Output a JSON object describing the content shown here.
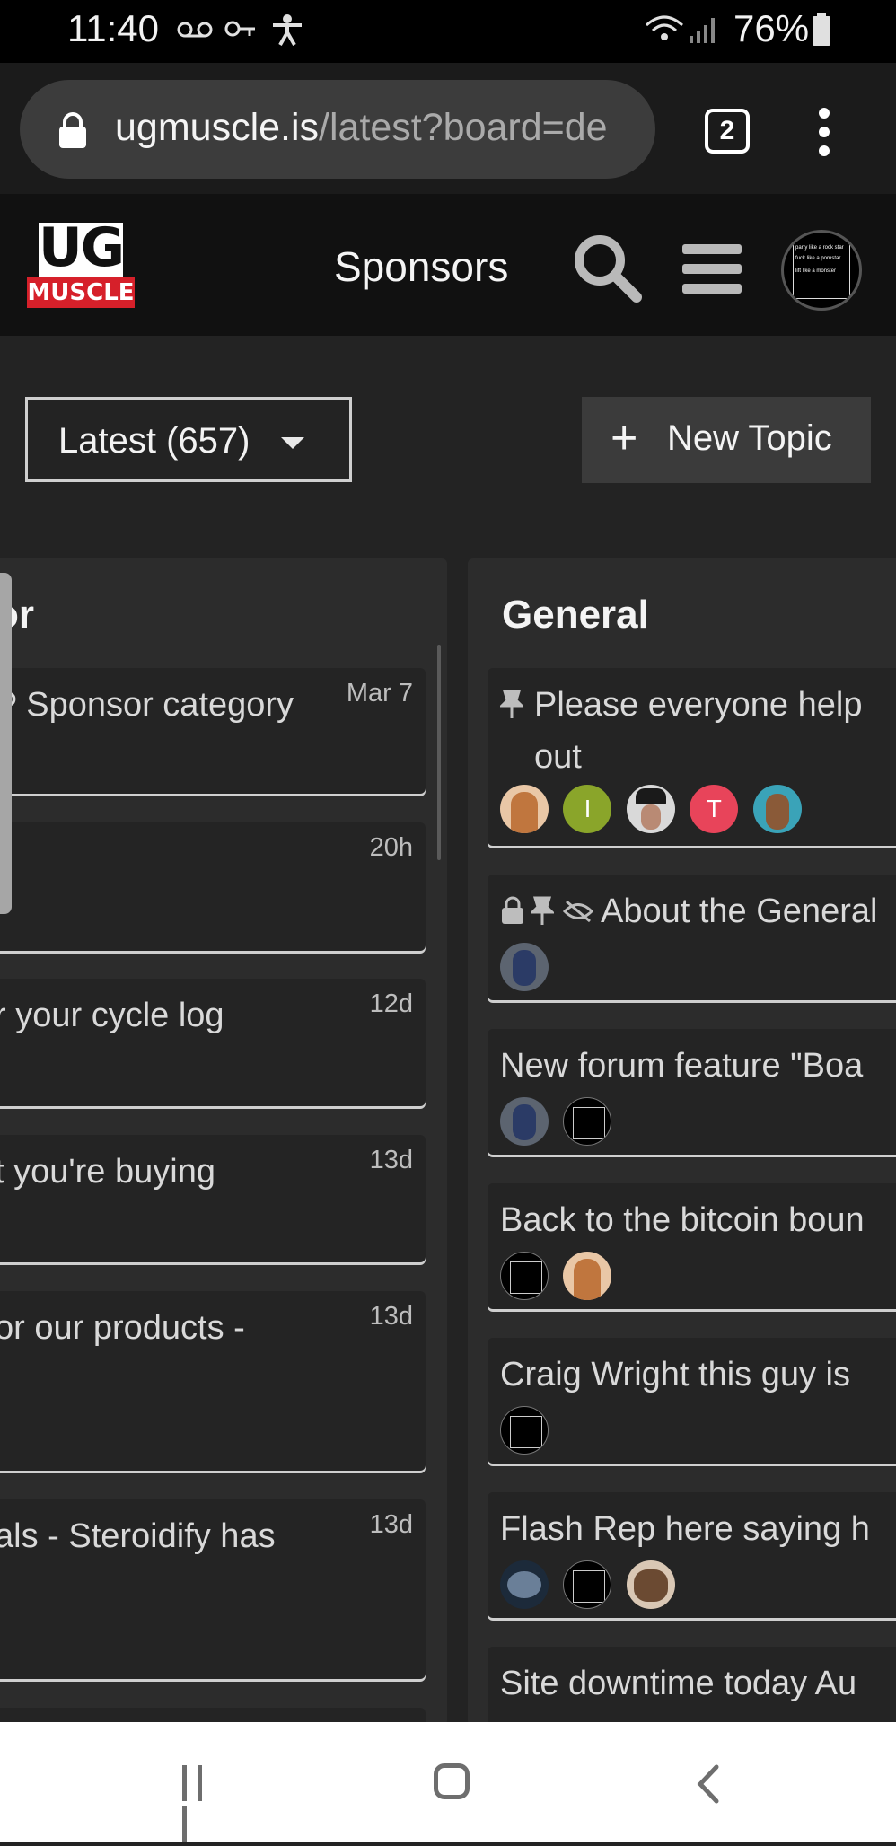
{
  "status_bar": {
    "time": "11:40",
    "battery": "76%"
  },
  "browser": {
    "url_host": "ugmuscle.is",
    "url_path": "/latest?board=de",
    "tab_count": "2"
  },
  "site_header": {
    "logo_top": "UG",
    "logo_bottom": "MUSCLE",
    "sponsors_label": "Sponsors",
    "avatar_lines": [
      "party like a rock star",
      "fuck like a pornstar",
      "lift like a monster"
    ]
  },
  "controls": {
    "latest_label": "Latest (657)",
    "new_topic_label": "New Topic"
  },
  "left_column": {
    "title": "or",
    "cards": [
      {
        "title": "P Sponsor category",
        "date": "Mar 7"
      },
      {
        "title": "",
        "date": "20h"
      },
      {
        "title": "r your cycle log",
        "date": "12d"
      },
      {
        "title": "t you're buying",
        "date": "13d"
      },
      {
        "title": "or our products -",
        "date": "13d"
      },
      {
        "title": "als - Steroidify has",
        "date": "13d"
      }
    ]
  },
  "right_column": {
    "title": "General",
    "cards": [
      {
        "title_line1": "Please everyone help",
        "title_line2": "out",
        "avatar_letters": [
          "I",
          "T"
        ]
      },
      {
        "title": "About the General"
      },
      {
        "title": "New forum feature \"Boa"
      },
      {
        "title": "Back to the bitcoin boun"
      },
      {
        "title": "Craig Wright this guy is"
      },
      {
        "title": "Flash Rep here saying h"
      },
      {
        "title": "Site downtime today Au"
      }
    ]
  },
  "colors": {
    "background": "#232323",
    "column": "#2c2c2c",
    "card": "#242424",
    "avatar_green": "#8aa52a",
    "avatar_pink": "#e8445a",
    "logo_red": "#d6202a"
  }
}
